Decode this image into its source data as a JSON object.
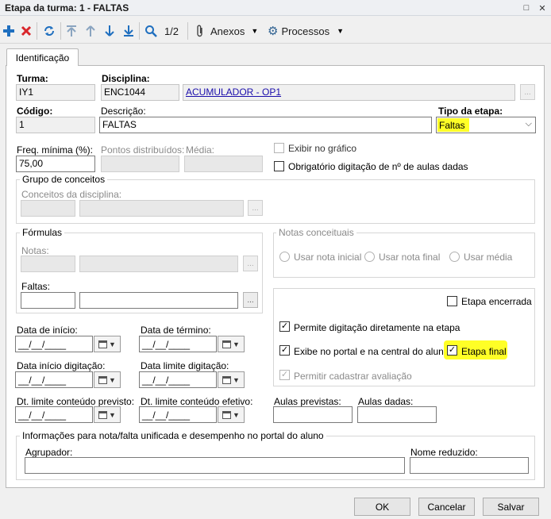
{
  "window": {
    "title": "Etapa da turma: 1 - FALTAS",
    "restore_glyph": "□",
    "close_glyph": "✕"
  },
  "toolbar": {
    "icons": [
      "add-icon",
      "delete-icon",
      "refresh-icon",
      "first-icon",
      "previous-icon",
      "next-icon",
      "last-icon",
      "search-icon"
    ],
    "colors": {
      "add": "#1f6fbf",
      "delete": "#d9262b",
      "nav": "#1f6fbf"
    },
    "pager": "1/2",
    "anexos": "Anexos",
    "processos": "Processos"
  },
  "tabs": {
    "identificacao": "Identificação"
  },
  "form": {
    "turma": {
      "label": "Turma:",
      "value": "IY1"
    },
    "disciplina": {
      "label": "Disciplina:",
      "code": "ENC1044",
      "name": "ACUMULADOR - OP1"
    },
    "codigo": {
      "label": "Código:",
      "value": "1"
    },
    "descricao": {
      "label": "Descrição:",
      "value": "FALTAS"
    },
    "tipo_etapa": {
      "label": "Tipo da etapa:",
      "value": "Faltas"
    },
    "freq_minima": {
      "label": "Freq. mínima (%):",
      "value": "75,00"
    },
    "pontos_distribuidos": {
      "label": "Pontos distribuídos:",
      "value": ""
    },
    "media": {
      "label": "Média:",
      "value": ""
    },
    "exibir_grafico": {
      "label": "Exibir no gráfico",
      "checked": false
    },
    "obrigatorio_aulas": {
      "label": "Obrigatório digitação de nº de aulas dadas",
      "checked": false
    },
    "grupo_conceitos": {
      "title": "Grupo de conceitos",
      "conceitos_label": "Conceitos da disciplina:"
    },
    "formulas": {
      "title": "Fórmulas",
      "notas_label": "Notas:",
      "faltas_label": "Faltas:"
    },
    "notas_conceituais": {
      "title": "Notas conceituais",
      "options": [
        "Usar nota inicial",
        "Usar nota final",
        "Usar média"
      ]
    },
    "etapa_encerrada": {
      "label": "Etapa encerrada",
      "checked": false
    },
    "permite_digitacao": {
      "label": "Permite digitação diretamente na etapa",
      "checked": true
    },
    "exibe_portal": {
      "label": "Exibe no portal e na central do aluno",
      "checked": true
    },
    "etapa_final": {
      "label": "Etapa final",
      "checked": true
    },
    "permitir_avaliacao": {
      "label": "Permitir cadastrar avaliação",
      "checked": true
    },
    "dates": {
      "data_inicio": {
        "label": "Data de início:",
        "value": "__/__/____"
      },
      "data_termino": {
        "label": "Data de término:",
        "value": "__/__/____"
      },
      "data_inicio_digitacao": {
        "label": "Data início digitação:",
        "value": "__/__/____"
      },
      "data_limite_digitacao": {
        "label": "Data limite digitação:",
        "value": "__/__/____"
      },
      "dt_limite_previsto": {
        "label": "Dt. limite conteúdo previsto:",
        "value": "__/__/____"
      },
      "dt_limite_efetivo": {
        "label": "Dt. limite conteúdo efetivo:",
        "value": "__/__/____"
      }
    },
    "aulas_previstas": {
      "label": "Aulas previstas:",
      "value": ""
    },
    "aulas_dadas": {
      "label": "Aulas dadas:",
      "value": ""
    },
    "info_unificada": {
      "title": "Informações para nota/falta unificada e desempenho no portal do aluno",
      "agrupador_label": "Agrupador:",
      "nome_reduzido_label": "Nome reduzido:"
    }
  },
  "footer": {
    "ok": "OK",
    "cancelar": "Cancelar",
    "salvar": "Salvar"
  },
  "colors": {
    "highlight": "#ffff26",
    "link": "#1a0dab"
  }
}
